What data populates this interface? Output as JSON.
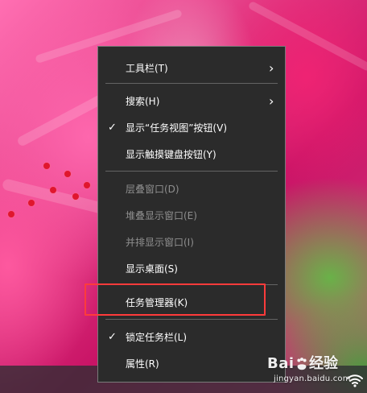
{
  "context_menu": {
    "items": [
      {
        "label": "工具栏(T)",
        "checked": false,
        "has_submenu": true,
        "enabled": true
      },
      {
        "label": "搜索(H)",
        "checked": false,
        "has_submenu": true,
        "enabled": true
      },
      {
        "label": "显示“任务视图”按钮(V)",
        "checked": true,
        "has_submenu": false,
        "enabled": true
      },
      {
        "label": "显示触摸键盘按钮(Y)",
        "checked": false,
        "has_submenu": false,
        "enabled": true
      },
      {
        "label": "层叠窗口(D)",
        "checked": false,
        "has_submenu": false,
        "enabled": false
      },
      {
        "label": "堆叠显示窗口(E)",
        "checked": false,
        "has_submenu": false,
        "enabled": false
      },
      {
        "label": "并排显示窗口(I)",
        "checked": false,
        "has_submenu": false,
        "enabled": false
      },
      {
        "label": "显示桌面(S)",
        "checked": false,
        "has_submenu": false,
        "enabled": true
      },
      {
        "label": "任务管理器(K)",
        "checked": false,
        "has_submenu": false,
        "enabled": true
      },
      {
        "label": "锁定任务栏(L)",
        "checked": true,
        "has_submenu": false,
        "enabled": true
      },
      {
        "label": "属性(R)",
        "checked": false,
        "has_submenu": false,
        "enabled": true
      }
    ],
    "check_glyph": "✓",
    "chevron_glyph": "›"
  },
  "watermark": {
    "brand_latin": "Bai",
    "brand_cn": "经验",
    "url": "jingyan.baidu.com"
  },
  "colors": {
    "menu_bg": "#2b2b2b",
    "menu_border": "#7a7a7a",
    "menu_text": "#ffffff",
    "menu_text_disabled": "#8f8f8f",
    "highlight": "#ff3b3b"
  }
}
